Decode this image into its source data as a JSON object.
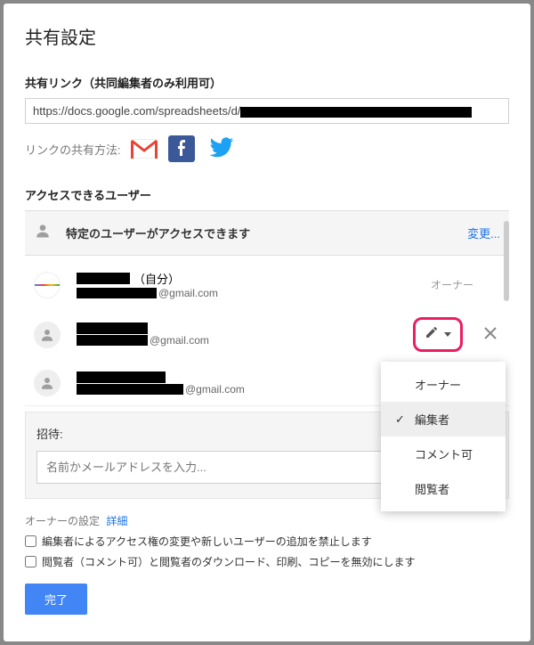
{
  "dialog": {
    "title": "共有設定",
    "link_section_label": "共有リンク（共同編集者のみ利用可）",
    "link_url_prefix": "https://docs.google.com/spreadsheets/d/",
    "share_via_label": "リンクの共有方法:",
    "access_section_label": "アクセスできるユーザー",
    "access_summary": "特定のユーザーがアクセスできます",
    "change_link": "変更...",
    "self_suffix": "（自分）",
    "email_domain": "@gmail.com",
    "owner_role": "オーナー",
    "invite_label": "招待:",
    "invite_placeholder": "名前かメールアドレスを入力...",
    "owner_settings_label": "オーナーの設定",
    "details_link": "詳細",
    "cb1": "編集者によるアクセス権の変更や新しいユーザーの追加を禁止します",
    "cb2": "閲覧者（コメント可）と閲覧者のダウンロード、印刷、コピーを無効にします",
    "done_button": "完了"
  },
  "dropdown": {
    "owner": "オーナー",
    "editor": "編集者",
    "commenter": "コメント可",
    "viewer": "閲覧者"
  },
  "icons": {
    "gmail": "gmail-icon",
    "facebook": "facebook-icon",
    "twitter": "twitter-icon",
    "person": "person-icon",
    "pencil": "pencil-icon",
    "close": "close-icon",
    "check": "check-icon"
  }
}
